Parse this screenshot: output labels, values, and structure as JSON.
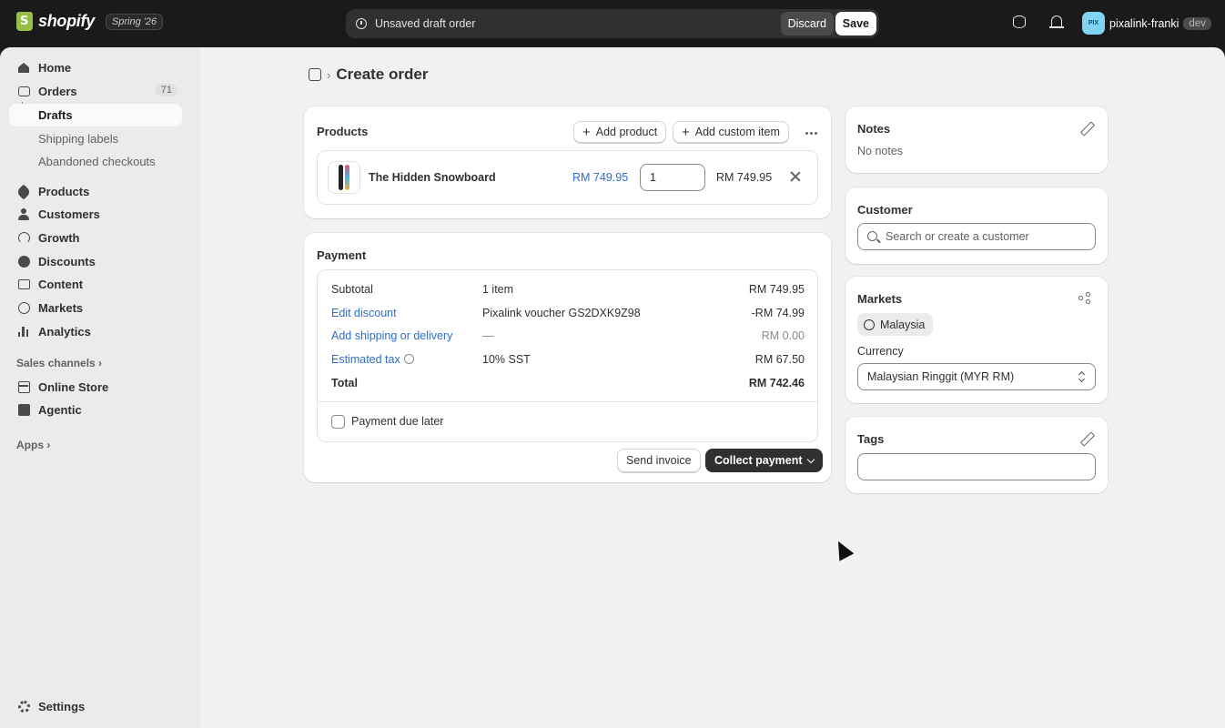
{
  "topbar": {
    "brand": "shopify",
    "edition": "Spring '26",
    "draft_message": "Unsaved draft order",
    "discard_label": "Discard",
    "save_label": "Save",
    "avatar_initials": "PIX",
    "store_name": "pixalink-franki",
    "env_tag": "dev"
  },
  "sidebar": {
    "home": "Home",
    "orders": "Orders",
    "orders_count": "71",
    "drafts": "Drafts",
    "shipping_labels": "Shipping labels",
    "abandoned": "Abandoned checkouts",
    "products": "Products",
    "customers": "Customers",
    "growth": "Growth",
    "discounts": "Discounts",
    "content": "Content",
    "markets": "Markets",
    "analytics": "Analytics",
    "sales_channels": "Sales channels",
    "online_store": "Online Store",
    "agentic": "Agentic",
    "apps": "Apps",
    "settings": "Settings"
  },
  "page": {
    "title": "Create order"
  },
  "products_card": {
    "title": "Products",
    "add_product": "Add product",
    "add_custom": "Add custom item",
    "item": {
      "name": "The Hidden Snowboard",
      "price": "RM 749.95",
      "quantity": "1",
      "total": "RM 749.95"
    }
  },
  "payment": {
    "title": "Payment",
    "rows": [
      {
        "label": "Subtotal",
        "detail": "1 item",
        "amount": "RM 749.95"
      },
      {
        "label": "Edit discount",
        "detail": "Pixalink voucher GS2DXK9Z98",
        "amount": "-RM 74.99"
      },
      {
        "label": "Add shipping or delivery",
        "detail": "—",
        "amount": "RM 0.00"
      },
      {
        "label": "Estimated tax",
        "detail": "10% SST",
        "amount": "RM 67.50"
      },
      {
        "label": "Total",
        "detail": "",
        "amount": "RM 742.46"
      }
    ],
    "due_later": "Payment due later",
    "send_invoice": "Send invoice",
    "collect": "Collect payment"
  },
  "notes": {
    "title": "Notes",
    "value": "No notes"
  },
  "customer": {
    "title": "Customer",
    "placeholder": "Search or create a customer"
  },
  "markets": {
    "title": "Markets",
    "market": "Malaysia",
    "currency_label": "Currency",
    "currency_value": "Malaysian Ringgit (MYR RM)"
  },
  "tags": {
    "title": "Tags",
    "value": ""
  },
  "colors": {
    "accent_link": "#2c6ecb",
    "topbar_bg": "#1a1a1a",
    "primary_button": "#303030"
  }
}
